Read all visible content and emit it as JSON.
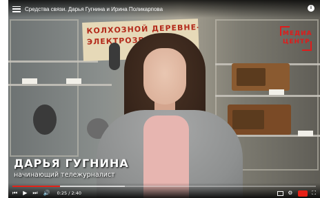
{
  "header": {
    "title": "Средства связи. Дарья Гугнина и Ирина Поликарпова",
    "menu_icon": "hamburger-menu-icon",
    "info_icon": "info-icon",
    "info_glyph": "i"
  },
  "video": {
    "poster_line1": "КОЛХОЗНОЙ ДЕРЕВНЕ-",
    "poster_line2": "ЭЛЕКТРОЗВОНОВ!",
    "logo_line1": "МЕДИА",
    "logo_line2": "ЦЕНТР",
    "caption_name": "ДАРЬЯ ГУГНИНА",
    "caption_role": "начинающий тележурналист"
  },
  "controls": {
    "time": "0:25 / 2:40",
    "progress_fraction": 0.156,
    "buffer_fraction": 0.37,
    "prev_glyph": "⏮",
    "play_glyph": "▶",
    "next_glyph": "⏭",
    "volume_glyph": "🔊",
    "settings_glyph": "⚙",
    "fullscreen_glyph": "⛶",
    "accent_color": "#e62117"
  }
}
